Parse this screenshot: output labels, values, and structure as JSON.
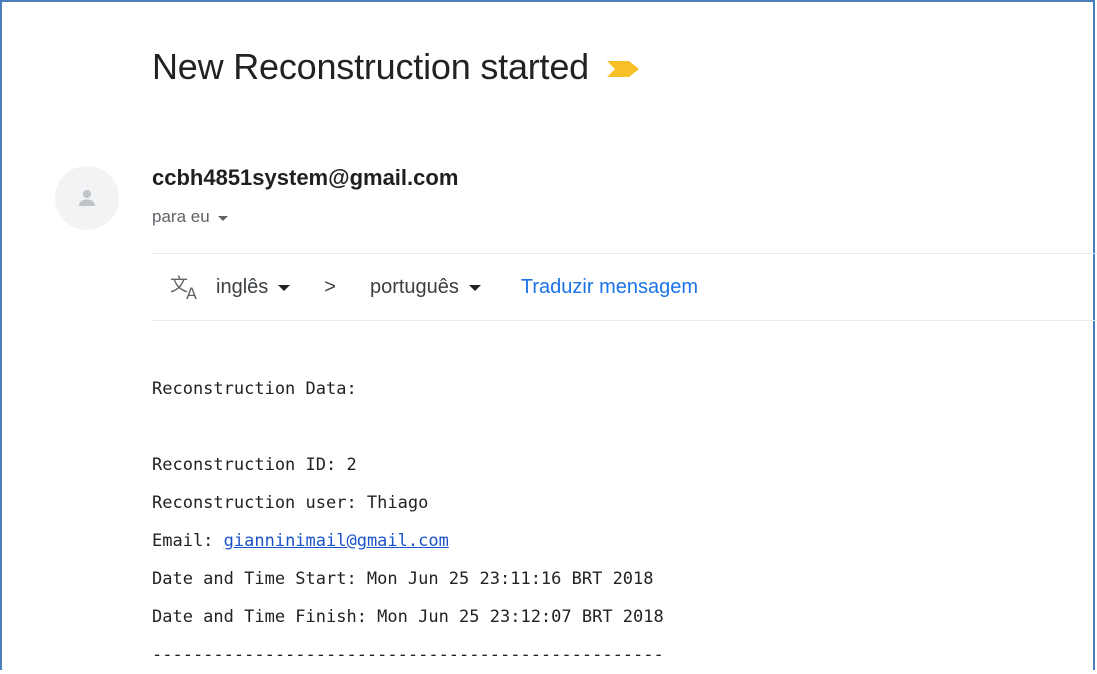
{
  "email": {
    "subject": "New Reconstruction started",
    "sender": "ccbh4851system@gmail.com",
    "recipient_label": "para eu"
  },
  "translate": {
    "from_lang": "inglês",
    "separator": ">",
    "to_lang": "português",
    "link": "Traduzir mensagem"
  },
  "body": {
    "heading": "Reconstruction Data:",
    "id_line": "Reconstruction ID: 2",
    "user_line": "Reconstruction user: Thiago",
    "email_prefix": "Email: ",
    "email_link": "gianninimail@gmail.com",
    "start_line": "Date and Time Start: Mon Jun 25 23:11:16 BRT 2018",
    "finish_line": "Date and Time Finish: Mon Jun 25 23:12:07 BRT 2018",
    "divider": "--------------------------------------------------"
  },
  "colors": {
    "important_marker": "#f6c026",
    "link": "#1a73e8",
    "frame_border": "#4a7ebb"
  },
  "icons": {
    "important": "important-marker-icon",
    "avatar": "person-icon",
    "translate": "translate-icon"
  }
}
